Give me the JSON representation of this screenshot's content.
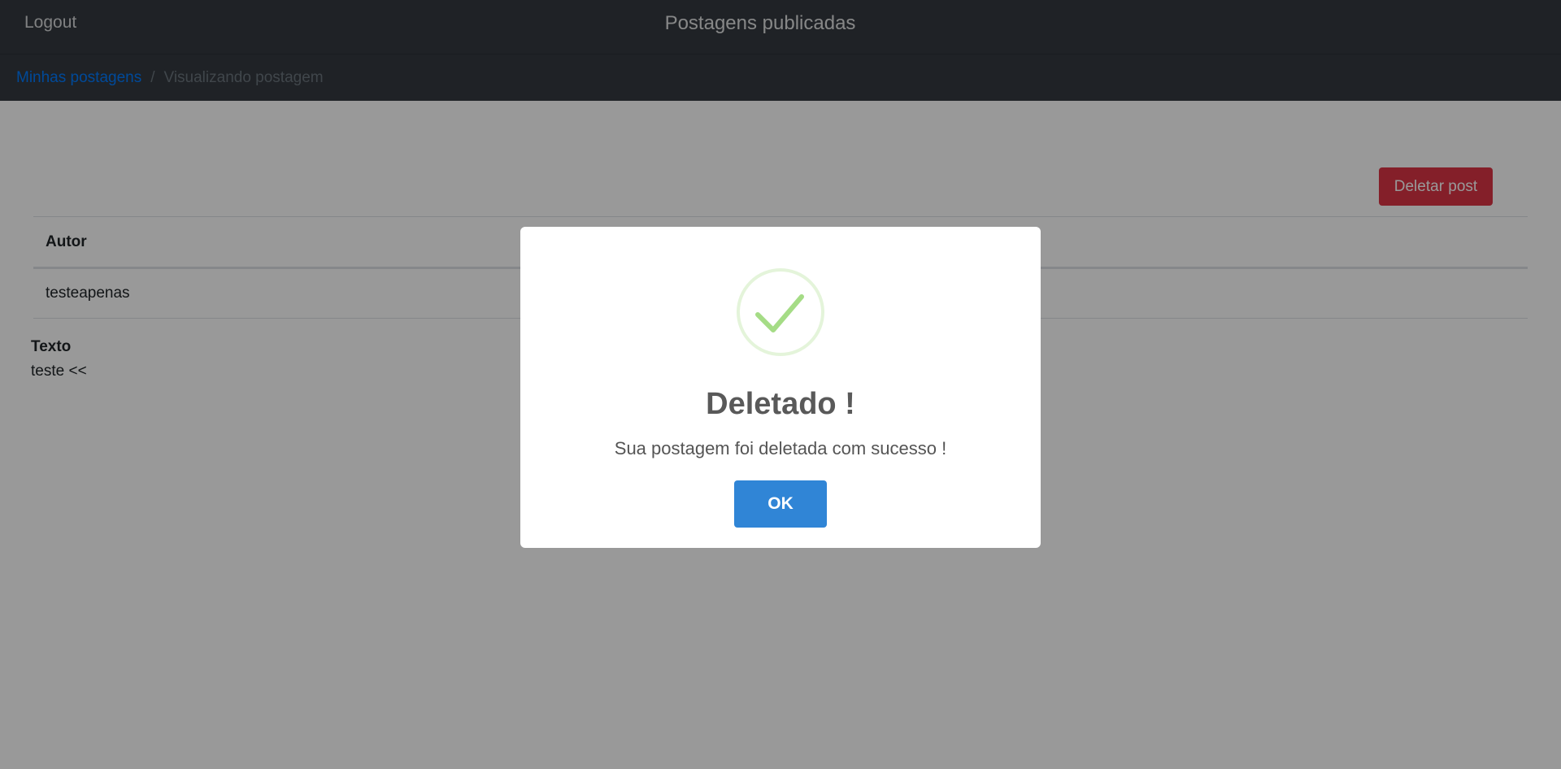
{
  "navbar": {
    "logout_label": "Logout",
    "title": "Postagens publicadas"
  },
  "breadcrumb": {
    "items": [
      {
        "label": "Minhas postagens"
      },
      {
        "label": "Visualizando postagem"
      }
    ],
    "separator": "/"
  },
  "actions": {
    "delete_label": "Deletar post"
  },
  "table": {
    "headers": [
      "Autor"
    ],
    "rows": [
      [
        "testeapenas"
      ]
    ]
  },
  "post": {
    "text_label": "Texto",
    "text_value": "teste <<"
  },
  "modal": {
    "icon": "success-check-icon",
    "title": "Deletado !",
    "message": "Sua postagem foi deletada com sucesso !",
    "ok_label": "OK"
  },
  "colors": {
    "navbar": "#343a40",
    "link": "#007bff",
    "danger": "#dc3545",
    "confirm": "#3085d6",
    "success": "#a5dc86"
  }
}
